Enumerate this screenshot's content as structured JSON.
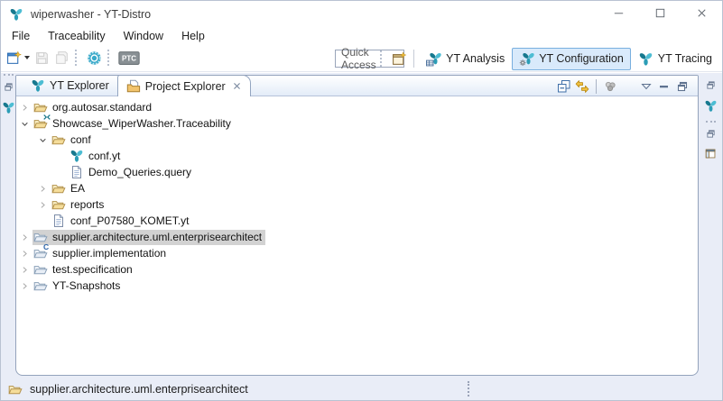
{
  "window": {
    "title": "wiperwasher - YT-Distro",
    "app_icon": "yt-logo-icon",
    "controls": [
      {
        "name": "minimize-button",
        "icon": "minimize-icon"
      },
      {
        "name": "maximize-button",
        "icon": "maximize-icon"
      },
      {
        "name": "close-button",
        "icon": "close-icon"
      }
    ]
  },
  "menu": {
    "items": [
      "File",
      "Traceability",
      "Window",
      "Help"
    ]
  },
  "toolbar": {
    "quick_access": "Quick Access",
    "ptc_label": "PTC",
    "items": [
      {
        "type": "button",
        "name": "new-wizard-button",
        "icon": "new-wizard-icon",
        "caret": true
      },
      {
        "type": "button",
        "name": "save-button",
        "icon": "save-icon",
        "disabled": true
      },
      {
        "type": "button",
        "name": "save-all-button",
        "icon": "save-all-icon",
        "disabled": true
      },
      {
        "type": "handle"
      },
      {
        "type": "button",
        "name": "komet-button",
        "icon": "komet-icon"
      },
      {
        "type": "handle"
      },
      {
        "type": "button",
        "name": "ptc-button",
        "icon": "ptc-icon",
        "wide": true
      }
    ],
    "perspective_bar": {
      "open_perspective": {
        "name": "open-perspective-button",
        "icon": "open-perspective-icon"
      },
      "perspectives": [
        {
          "label": "YT Analysis",
          "icon": "yt-analysis-icon",
          "active": false
        },
        {
          "label": "YT Configuration",
          "icon": "yt-configuration-icon",
          "active": true
        },
        {
          "label": "YT Tracing",
          "icon": "yt-tracing-icon",
          "active": false
        }
      ]
    }
  },
  "explorer": {
    "tabs": [
      {
        "label": "YT Explorer",
        "icon": "yt-logo-icon",
        "active": false,
        "closable": false
      },
      {
        "label": "Project Explorer",
        "icon": "project-explorer-icon",
        "active": true,
        "closable": true
      }
    ],
    "view_toolbar": [
      {
        "name": "collapse-all-button",
        "icon": "collapse-all-icon"
      },
      {
        "name": "link-with-editor-button",
        "icon": "link-with-editor-icon"
      },
      {
        "sep": true
      },
      {
        "name": "working-set-button",
        "icon": "working-set-icon",
        "disabled": true
      },
      {
        "name": "view-menu-button",
        "icon": "view-menu-icon",
        "gap": true
      },
      {
        "name": "minimize-view-button",
        "icon": "minimize-view-icon"
      },
      {
        "name": "maximize-view-button",
        "icon": "maximize-view-icon"
      }
    ],
    "tree": [
      {
        "label": "org.autosar.standard",
        "indent": 0,
        "chevron": "collapsed",
        "icon": "folder-open-icon"
      },
      {
        "label": "Showcase_WiperWasher.Traceability",
        "indent": 0,
        "chevron": "expanded",
        "icon": "folder-open-icon",
        "decorator": {
          "type": "icon",
          "value": "yt-decorator-icon"
        }
      },
      {
        "label": "conf",
        "indent": 1,
        "chevron": "expanded",
        "icon": "folder-open-icon"
      },
      {
        "label": "conf.yt",
        "indent": 2,
        "chevron": "none",
        "icon": "yt-file-icon"
      },
      {
        "label": "Demo_Queries.query",
        "indent": 2,
        "chevron": "none",
        "icon": "file-icon"
      },
      {
        "label": "EA",
        "indent": 1,
        "chevron": "collapsed",
        "icon": "folder-open-icon"
      },
      {
        "label": "reports",
        "indent": 1,
        "chevron": "collapsed",
        "icon": "folder-open-icon"
      },
      {
        "label": "conf_P07580_KOMET.yt",
        "indent": 1,
        "chevron": "none",
        "icon": "file-icon"
      },
      {
        "label": "supplier.architecture.uml.enterprisearchitect",
        "indent": 0,
        "chevron": "collapsed",
        "icon": "folder-closed-icon",
        "selected": true
      },
      {
        "label": "supplier.implementation",
        "indent": 0,
        "chevron": "collapsed",
        "icon": "folder-closed-icon",
        "decorator": {
          "type": "text",
          "value": "C"
        }
      },
      {
        "label": "test.specification",
        "indent": 0,
        "chevron": "collapsed",
        "icon": "folder-closed-icon"
      },
      {
        "label": "YT-Snapshots",
        "indent": 0,
        "chevron": "collapsed",
        "icon": "folder-closed-icon"
      }
    ]
  },
  "left_trim": [
    {
      "name": "restore-pane-button",
      "icon": "restore-pane-icon"
    },
    {
      "name": "minimized-yt-view-button",
      "icon": "yt-logo-icon",
      "logo": true
    }
  ],
  "right_trim": [
    {
      "name": "restore-pane-button",
      "icon": "restore-pane-icon"
    },
    {
      "name": "minimized-yt-view-button",
      "icon": "yt-logo-icon",
      "logo": true
    },
    {
      "handle": true
    },
    {
      "name": "restore-pane-button-2",
      "icon": "restore-pane-icon"
    },
    {
      "name": "minimized-outline-view-button",
      "icon": "layout-pane-icon"
    }
  ],
  "statusbar": {
    "selection_label": "supplier.architecture.uml.enterprisearchitect",
    "icon": "folder-open-icon"
  },
  "colors": {
    "accent_teal": "#2b9db6",
    "active_perspective_bg": "#d9eafb",
    "active_perspective_border": "#79afdf",
    "selection_bg": "#d2d2d2",
    "frame_bg": "#e9edf7",
    "panel_border": "#94a3bc"
  }
}
